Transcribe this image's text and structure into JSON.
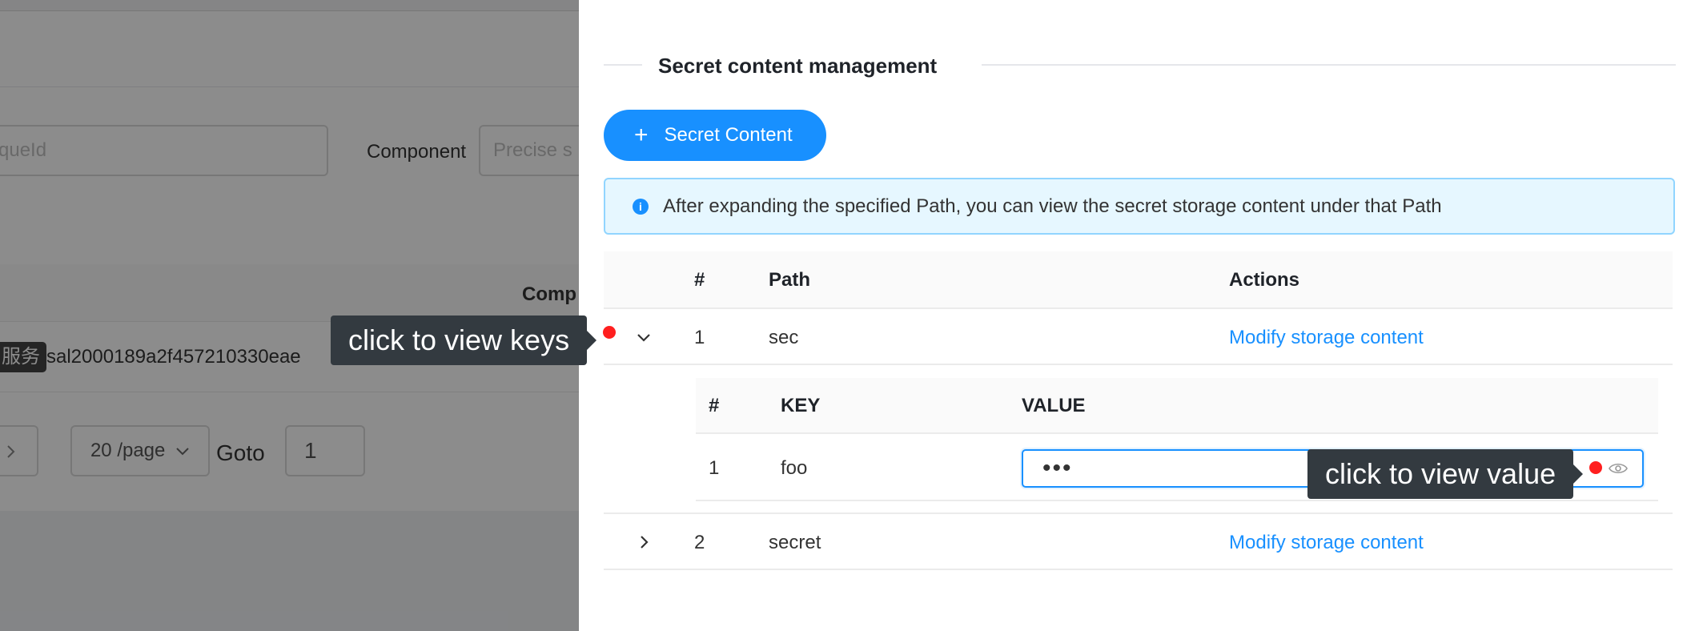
{
  "background": {
    "search_placeholder_partial": "queId",
    "component_label": "Component",
    "component_placeholder_partial": "Precise s",
    "column_header_partial": "Comp",
    "tag_partial": "服务",
    "row_id_partial": "sal2000189a2f457210330eae",
    "page_size": "20 /page",
    "goto_label": "Goto",
    "goto_value": "1",
    "next_icon": "chevron-right-icon"
  },
  "drawer": {
    "section_title": "Secret content management",
    "add_button_label": "Secret Content",
    "add_button_icon": "+",
    "alert_text": "After expanding the specified Path, you can view the secret storage content under that Path",
    "table": {
      "headers": {
        "index": "#",
        "path": "Path",
        "actions": "Actions"
      },
      "rows": [
        {
          "index": "1",
          "path": "sec",
          "action": "Modify storage content",
          "expanded": true
        },
        {
          "index": "2",
          "path": "secret",
          "action": "Modify storage content",
          "expanded": false
        }
      ]
    },
    "nested_table": {
      "headers": {
        "index": "#",
        "key": "KEY",
        "value": "VALUE"
      },
      "rows": [
        {
          "index": "1",
          "key": "foo",
          "value_masked": "•••"
        }
      ]
    }
  },
  "annotations": {
    "keys_tooltip": "click to view keys",
    "value_tooltip": "click to view value",
    "dot_color": "#ff1f1f"
  },
  "colors": {
    "primary": "#1890ff",
    "alert_bg": "#e6f7ff",
    "alert_border": "#91d5ff",
    "tooltip_bg": "#333a40",
    "mask": "rgba(0,0,0,0.45)"
  }
}
